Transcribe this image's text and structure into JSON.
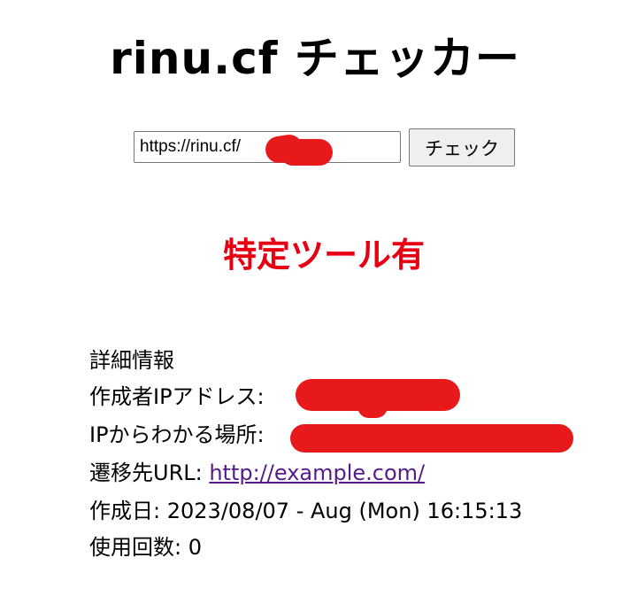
{
  "header": {
    "title": "rinu.cf チェッカー"
  },
  "form": {
    "url_value": "https://rinu.cf/",
    "check_label": "チェック"
  },
  "result": {
    "status_text": "特定ツール有",
    "status_color": "#e60012"
  },
  "details": {
    "heading": "詳細情報",
    "ip_label": "作成者IPアドレス:",
    "location_label": "IPからわかる場所:",
    "redirect_label": "遷移先URL:",
    "redirect_url": "http://example.com/",
    "created_label": "作成日:",
    "created_value": "2023/08/07 - Aug (Mon) 16:15:13",
    "usage_label": "使用回数:",
    "usage_value": "0"
  },
  "colors": {
    "redaction": "#e8191b",
    "link": "#551a8b"
  }
}
